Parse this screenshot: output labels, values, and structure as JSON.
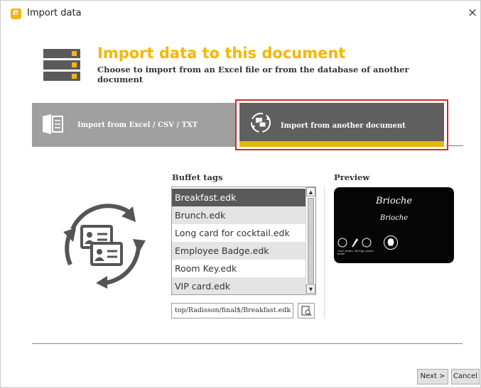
{
  "window": {
    "title": "Import data",
    "close_glyph": "×"
  },
  "header": {
    "title": "Import data to this document",
    "subtitle": "Choose to import from an Excel file or from the database of another document",
    "icon": "database-server-icon"
  },
  "tabs": [
    {
      "label": "Import from Excel / CSV / TXT",
      "icon": "excel-file-icon",
      "selected": false
    },
    {
      "label": "Import from another document",
      "icon": "document-sync-icon",
      "selected": true
    }
  ],
  "list": {
    "title": "Buffet tags",
    "items": [
      {
        "label": "Breakfast.edk",
        "selected": true
      },
      {
        "label": "Brunch.edk",
        "selected": false
      },
      {
        "label": "Long card for cocktail.edk",
        "selected": false
      },
      {
        "label": "Employee Badge.edk",
        "selected": false
      },
      {
        "label": "Room Key.edk",
        "selected": false
      },
      {
        "label": "VIP card.edk",
        "selected": false
      }
    ],
    "scroll_up": "▲",
    "scroll_down": "▼"
  },
  "path": {
    "value": "top/Radisson/final$/Breakfast.edk"
  },
  "preview": {
    "title": "Preview",
    "card_title": "Brioche",
    "card_subtitle": "Brioche",
    "card_allergens_text": "Oeuf, gluten, lait\nEgg, gluten, butter"
  },
  "buttons": {
    "next": "Next >",
    "cancel": "Cancel"
  },
  "colors": {
    "accent": "#f5b700",
    "highlight_border": "#d8272a",
    "tab_inactive": "#a0a0a0",
    "tab_active": "#5f5f5f"
  }
}
